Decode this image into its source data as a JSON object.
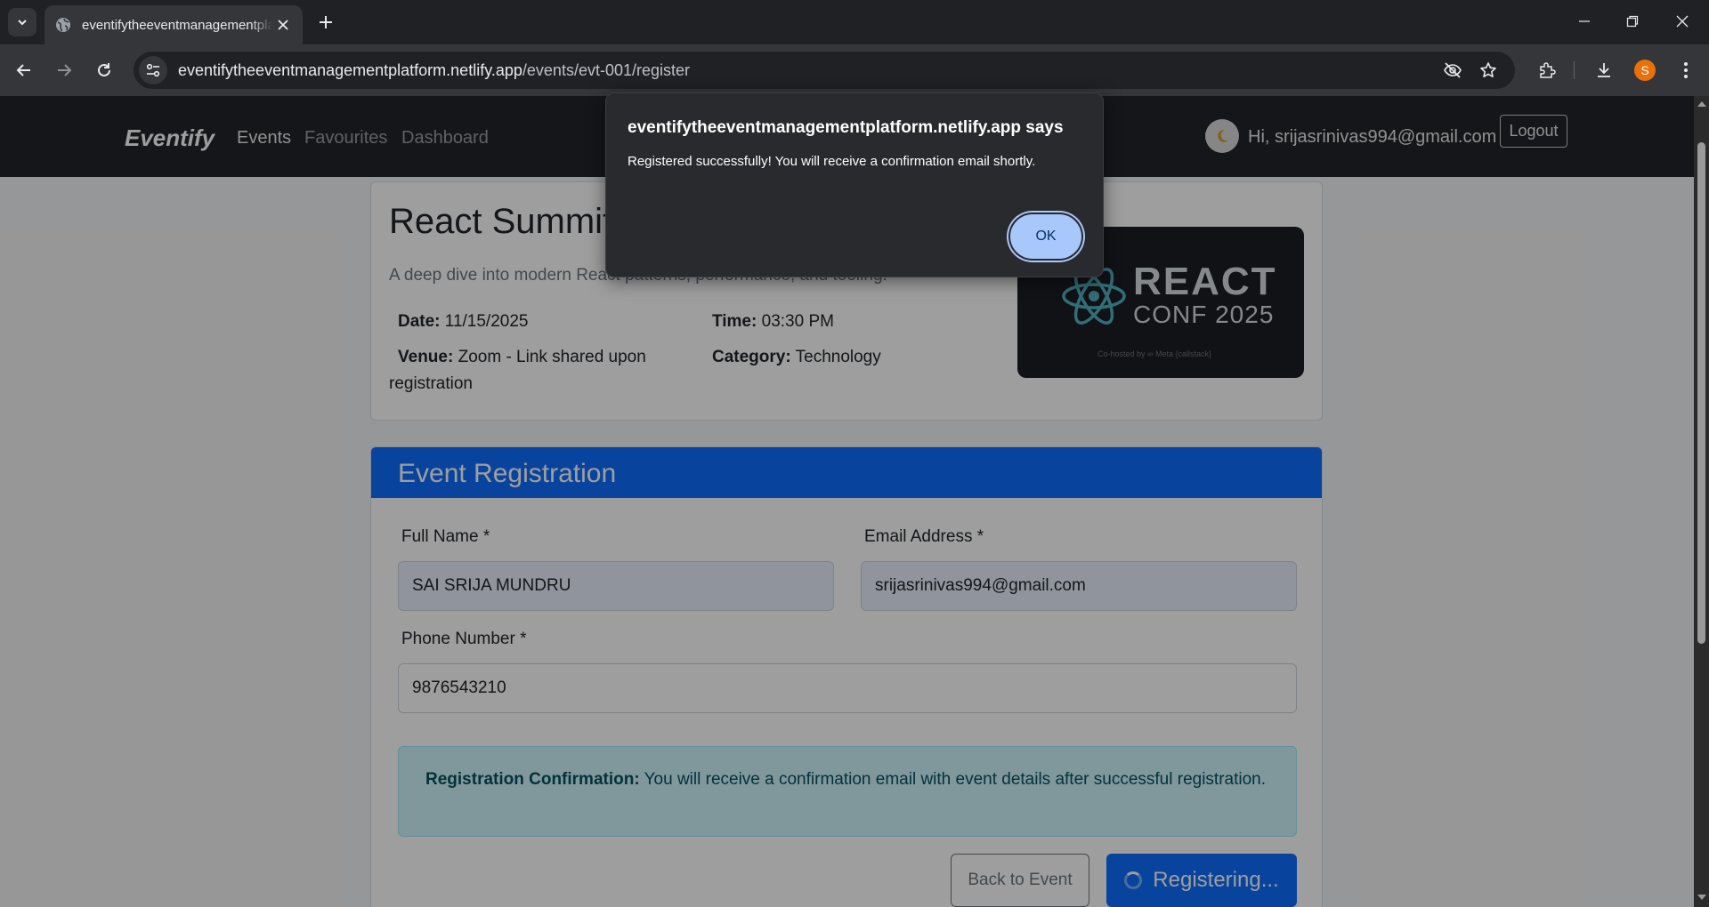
{
  "browser": {
    "tab_title": "eventifytheeventmanagementplatform.netlify.app/events/evt-001/register",
    "url_host": "eventifytheeventmanagementplatform.netlify.app",
    "url_path": "/events/evt-001/register",
    "profile_initial": "S"
  },
  "navbar": {
    "brand": "Eventify",
    "links": [
      "Events",
      "Favourites",
      "Dashboard"
    ],
    "greeting": "Hi, srijasrinivas994@gmail.com",
    "logout": "Logout"
  },
  "event": {
    "title": "React Summit",
    "description": "A deep dive into modern React patterns, performance, and tooling.",
    "date_label": "Date:",
    "date_value": "11/15/2025",
    "time_label": "Time:",
    "time_value": "03:30 PM",
    "venue_label": "Venue:",
    "venue_value": "Zoom - Link shared upon registration",
    "category_label": "Category:",
    "category_value": "Technology",
    "image": {
      "title": "REACT",
      "subtitle": "CONF 2025",
      "cohost": "Co-hosted by   ∞ Meta   {callstack}"
    }
  },
  "registration": {
    "header": "Event Registration",
    "full_name_label": "Full Name *",
    "full_name_value": "SAI SRIJA MUNDRU",
    "email_label": "Email Address *",
    "email_value": "srijasrinivas994@gmail.com",
    "phone_label": "Phone Number *",
    "phone_value": "9876543210",
    "alert_title": "Registration Confirmation:",
    "alert_text": "You will receive a confirmation email with event details after successful registration.",
    "back_button": "Back to Event",
    "submit_button": "Registering..."
  },
  "dialog": {
    "title": "eventifytheeventmanagementplatform.netlify.app says",
    "message": "Registered successfully! You will receive a confirmation email shortly.",
    "ok": "OK"
  },
  "colors": {
    "primary": "#0d6efd",
    "navbar": "#212529",
    "dialog": "#292a2d",
    "ok_button": "#a8c7fa"
  }
}
